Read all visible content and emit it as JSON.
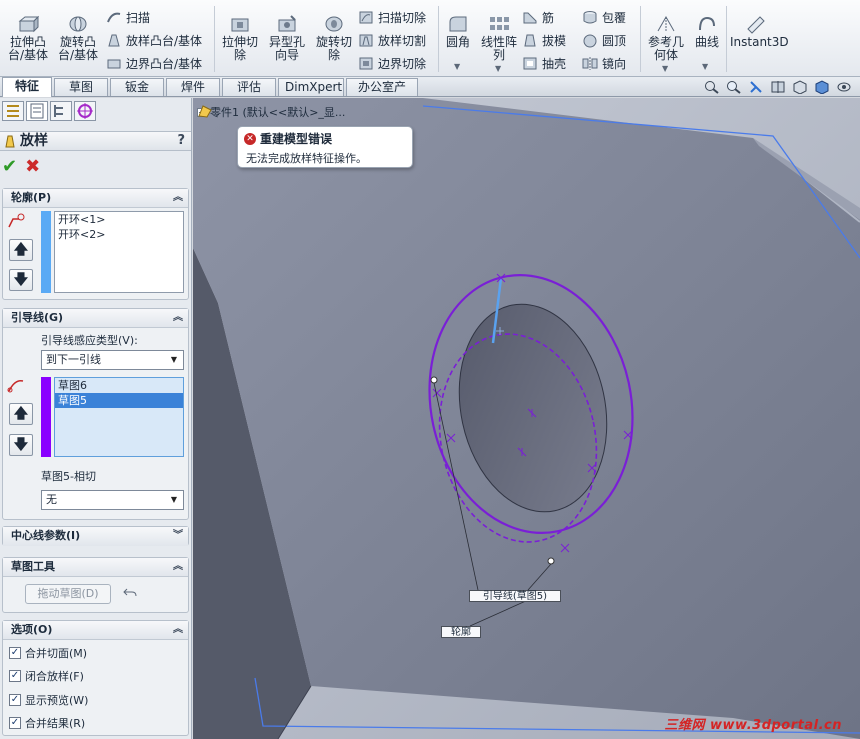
{
  "ribbon": {
    "extrude_boss": "拉伸凸\n台/基体",
    "revolve_boss": "旋转凸\n台/基体",
    "sweep": "扫描",
    "loft_boss": "放样凸台/基体",
    "boundary_boss": "边界凸台/基体",
    "extrude_cut": "拉伸切\n除",
    "hole_wizard": "异型孔\n向导",
    "revolve_cut": "旋转切\n除",
    "swept_cut": "扫描切除",
    "lofted_cut": "放样切割",
    "boundary_cut": "边界切除",
    "fillet": "圆角",
    "linear_pattern": "线性阵\n列",
    "rib": "筋",
    "draft": "拔模",
    "shell": "抽壳",
    "wrap": "包覆",
    "dome": "圆顶",
    "mirror": "镜向",
    "ref_geometry": "参考几\n何体",
    "curves": "曲线",
    "instant3d": "Instant3D"
  },
  "tabs": [
    "特征",
    "草图",
    "钣金",
    "焊件",
    "评估",
    "DimXpert",
    "办公室产品"
  ],
  "panel": {
    "title": "放样",
    "help": "?",
    "profiles": {
      "header": "轮廓(P)",
      "items": [
        "开环<1>",
        "开环<2>"
      ]
    },
    "guides": {
      "header": "引导线(G)",
      "influence_label": "引导线感应类型(V):",
      "influence_value": "到下一引线",
      "items": [
        "草图6",
        "草图5"
      ],
      "tangency_label": "草图5-相切",
      "tangency_value": "无"
    },
    "centerline": {
      "header": "中心线参数(I)"
    },
    "sketch_tools": {
      "header": "草图工具",
      "drag_button": "拖动草图(D)"
    },
    "options": {
      "header": "选项(O)",
      "checkboxes": [
        {
          "label": "合并切面(M)",
          "checked": true
        },
        {
          "label": "闭合放样(F)",
          "checked": true
        },
        {
          "label": "显示预览(W)",
          "checked": true
        },
        {
          "label": "合并结果(R)",
          "checked": true
        }
      ]
    }
  },
  "viewport": {
    "tree_label": "零件1  (默认<<默认>_显...",
    "error_title": "重建模型错误",
    "error_message": "无法完成放样特征操作。",
    "callout_guide": "引导线(草图5)",
    "callout_profile": "轮廓",
    "watermark": "三维网 www.3dportal.cn"
  },
  "colors": {
    "profile_bar": "#5aaaf5",
    "guide_bar": "#8a00ff",
    "sketch_purple": "#7a1fd6",
    "sketch_blue": "#5aa2f0",
    "error_red": "#c62828"
  }
}
